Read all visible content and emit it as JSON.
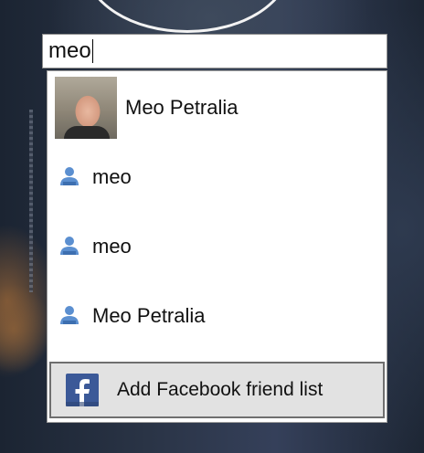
{
  "search": {
    "value": "meo"
  },
  "results": [
    {
      "label": "Meo Petralia",
      "icon": "profile-photo"
    },
    {
      "label": "meo",
      "icon": "person-icon"
    },
    {
      "label": "meo",
      "icon": "person-icon"
    },
    {
      "label": "Meo Petralia",
      "icon": "person-icon"
    }
  ],
  "footer": {
    "label": "Add Facebook friend list",
    "icon": "facebook-icon"
  },
  "colors": {
    "facebook_blue": "#3b5998",
    "person_icon_blue": "#5b8fd0"
  }
}
